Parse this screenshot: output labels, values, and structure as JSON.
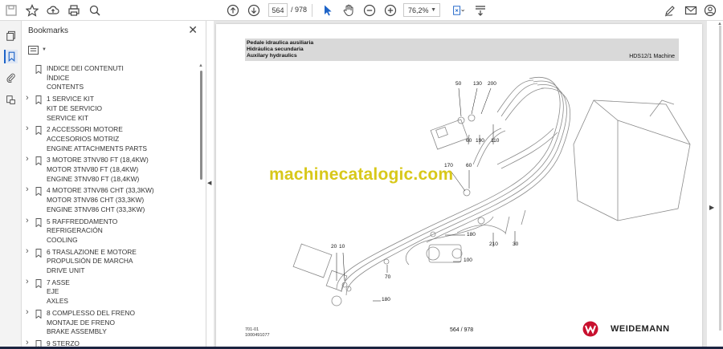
{
  "toolbar": {
    "current_page": "564",
    "total_pages": "/ 978",
    "zoom": "76,2%"
  },
  "panel": {
    "title": "Bookmarks",
    "close": "✕"
  },
  "bookmarks": [
    {
      "expandable": false,
      "lines": [
        "INDICE DEI CONTENUTI",
        "ÍNDICE",
        "CONTENTS"
      ]
    },
    {
      "expandable": true,
      "lines": [
        "1 SERVICE KIT",
        "KIT DE SERVICIO",
        "SERVICE KIT"
      ]
    },
    {
      "expandable": true,
      "lines": [
        "2 ACCESSORI MOTORE",
        "ACCESORIOS MOTRIZ",
        "ENGINE ATTACHMENTS PARTS"
      ]
    },
    {
      "expandable": true,
      "lines": [
        "3 MOTORE 3TNV80 FT (18,4KW)",
        "MOTOR 3TNV80 FT (18,4KW)",
        "ENGINE 3TNV80 FT (18,4KW)"
      ]
    },
    {
      "expandable": true,
      "lines": [
        "4 MOTORE 3TNV86 CHT (33,3KW)",
        "MOTOR 3TNV86 CHT (33,3KW)",
        "ENGINE 3TNV86 CHT (33,3KW)"
      ]
    },
    {
      "expandable": true,
      "lines": [
        "5 RAFFREDDAMENTO",
        "REFRIGERACIÓN",
        "COOLING"
      ]
    },
    {
      "expandable": true,
      "lines": [
        "6 TRASLAZIONE E MOTORE",
        "PROPULSIÓN DE MARCHA",
        "DRIVE UNIT"
      ]
    },
    {
      "expandable": true,
      "lines": [
        "7 ASSE",
        "EJE",
        "AXLES"
      ]
    },
    {
      "expandable": true,
      "lines": [
        "8 COMPLESSO DEL FRENO",
        "MONTAJE DE FRENO",
        "BRAKE ASSEMBLY"
      ]
    },
    {
      "expandable": true,
      "lines": [
        "9 STERZO"
      ]
    }
  ],
  "document": {
    "header": {
      "line1": "Pedale idraulica ausiliaria",
      "line2": "Hidráulica secundaria",
      "line3": "Auxilary hydraulics",
      "model": "HDS12/1 Machine"
    },
    "watermark": "machinecatalogic.com",
    "part_labels": [
      "50",
      "130",
      "200",
      "60",
      "190",
      "110",
      "170",
      "60",
      "180",
      "210",
      "30",
      "20",
      "10",
      "100",
      "70",
      "180"
    ],
    "footer": {
      "code1": "701-01",
      "code2": "1000491077",
      "page": "564 / 978",
      "brand": "WEIDEMANN"
    }
  },
  "colors": {
    "watermark": "#d8c81a",
    "brand_red": "#c8102e",
    "header_band": "#d9d9d9"
  }
}
